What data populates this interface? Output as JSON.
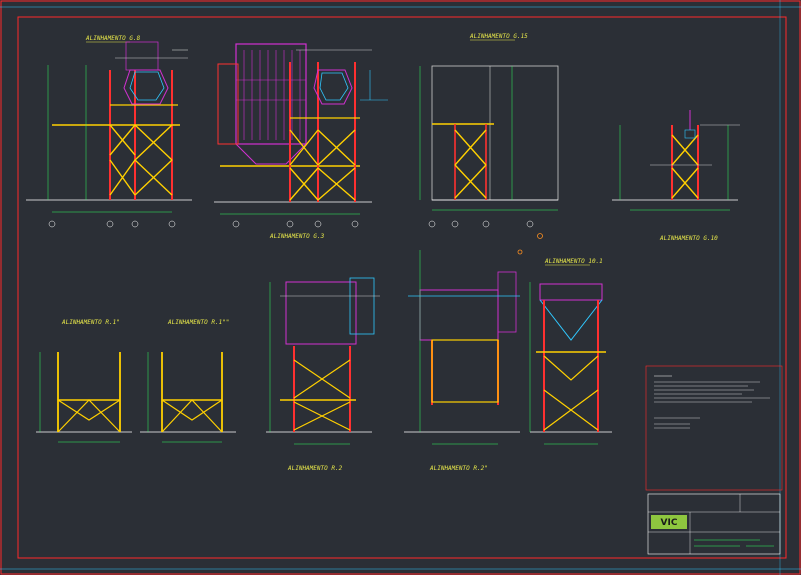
{
  "views": {
    "v1": "ALINHAMENTO G.8",
    "v2": "ALINHAMENTO G.3",
    "v3": "ALINHAMENTO G.15",
    "v4": "ALINHAMENTO G.10",
    "v5": "ALINHAMENTO R.1\"",
    "v6": "ALINHAMENTO R.1\"\"",
    "v7": "ALINHAMENTO R.2",
    "v8": "ALINHAMENTO R.2\"",
    "v9": "ALINHAMENTO 10.1"
  },
  "titleblock": {
    "logo": "VIC"
  }
}
